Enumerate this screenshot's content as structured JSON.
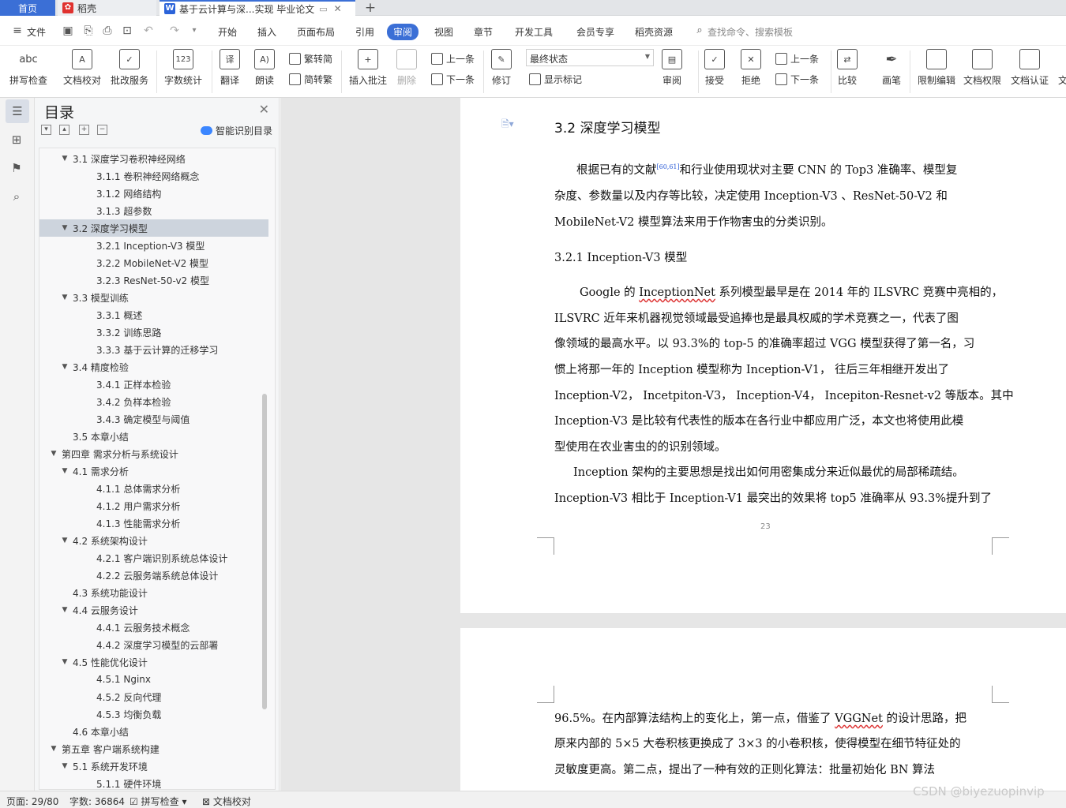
{
  "tabs": {
    "home": "首页",
    "docer": "稻壳",
    "document": "基于云计算与深...实现 毕业论文",
    "add_symbol": "+"
  },
  "menu": {
    "file": "文件",
    "items": [
      "开始",
      "插入",
      "页面布局",
      "引用",
      "审阅",
      "视图",
      "章节",
      "开发工具",
      "会员专享",
      "稻壳资源"
    ],
    "active": "审阅",
    "search_placeholder": "查找命令、搜索模板"
  },
  "ribbon": {
    "spell_check": "拼写检查",
    "doc_proofread": "文档校对",
    "batch_service": "批改服务",
    "word_count": "字数统计",
    "translate": "翻译",
    "read_aloud": "朗读",
    "trad_to_simp": "繁转简",
    "simp_to_trad": "简转繁",
    "insert_comment": "插入批注",
    "delete": "删除",
    "prev": "上一条",
    "next": "下一条",
    "revise": "修订",
    "status_value": "最终状态",
    "show_marks": "显示标记",
    "review": "审阅",
    "accept": "接受",
    "reject": "拒绝",
    "prev2": "上一条",
    "next2": "下一条",
    "compare": "比较",
    "pen": "画笔",
    "restrict_edit": "限制编辑",
    "doc_permission": "文档权限",
    "doc_cert": "文档认证",
    "cut_off": "文"
  },
  "toc": {
    "title": "目录",
    "smart_label": "智能识别目录",
    "items": [
      {
        "label": "3.1  深度学习卷积神经网络",
        "level": 2,
        "expand": "down"
      },
      {
        "label": "3.1.1  卷积神经网络概念",
        "level": 3
      },
      {
        "label": "3.1.2  网络结构",
        "level": 3
      },
      {
        "label": "3.1.3  超参数",
        "level": 3
      },
      {
        "label": "3.2  深度学习模型",
        "level": 2,
        "expand": "down",
        "selected": true
      },
      {
        "label": "3.2.1 Inception-V3 模型",
        "level": 3
      },
      {
        "label": "3.2.2 MobileNet-V2 模型",
        "level": 3
      },
      {
        "label": "3.2.3 ResNet-50-v2 模型",
        "level": 3
      },
      {
        "label": "3.3  模型训练",
        "level": 2,
        "expand": "down"
      },
      {
        "label": "3.3.1  概述",
        "level": 3
      },
      {
        "label": "3.3.2  训练思路",
        "level": 3
      },
      {
        "label": "3.3.3  基于云计算的迁移学习",
        "level": 3
      },
      {
        "label": "3.4  精度检验",
        "level": 2,
        "expand": "down"
      },
      {
        "label": "3.4.1  正样本检验",
        "level": 3
      },
      {
        "label": "3.4.2  负样本检验",
        "level": 3
      },
      {
        "label": "3.4.3  确定模型与阈值",
        "level": 3
      },
      {
        "label": "3.5  本章小结",
        "level": 2
      },
      {
        "label": "第四章  需求分析与系统设计",
        "level": 1,
        "expand": "down"
      },
      {
        "label": "4.1  需求分析",
        "level": 2,
        "expand": "down"
      },
      {
        "label": "4.1.1  总体需求分析",
        "level": 3
      },
      {
        "label": "4.1.2  用户需求分析",
        "level": 3
      },
      {
        "label": "4.1.3  性能需求分析",
        "level": 3
      },
      {
        "label": "4.2  系统架构设计",
        "level": 2,
        "expand": "down"
      },
      {
        "label": "4.2.1  客户端识别系统总体设计",
        "level": 3
      },
      {
        "label": "4.2.2  云服务端系统总体设计",
        "level": 3
      },
      {
        "label": "4.3  系统功能设计",
        "level": 2
      },
      {
        "label": "4.4  云服务设计",
        "level": 2,
        "expand": "down"
      },
      {
        "label": "4.4.1  云服务技术概念",
        "level": 3
      },
      {
        "label": "4.4.2 深度学习模型的云部署",
        "level": 3
      },
      {
        "label": "4.5  性能优化设计",
        "level": 2,
        "expand": "down"
      },
      {
        "label": "4.5.1 Nginx",
        "level": 3
      },
      {
        "label": "4.5.2  反向代理",
        "level": 3
      },
      {
        "label": "4.5.3  均衡负载",
        "level": 3
      },
      {
        "label": "4.6 本章小结",
        "level": 2
      },
      {
        "label": "第五章  客户端系统构建",
        "level": 1,
        "expand": "down"
      },
      {
        "label": "5.1 系统开发环境",
        "level": 2,
        "expand": "down"
      },
      {
        "label": "5.1.1  硬件环境",
        "level": 3
      }
    ]
  },
  "document": {
    "heading": "3.2  深度学习模型",
    "p1_l1a": "根据已有的文献",
    "p1_ref": "[60,61]",
    "p1_l1b": "和行业使用现状对主要  CNN  的  Top3  准确率、模型复",
    "p1_l2": "杂度、参数量以及内存等比较，决定使用  Inception-V3  、ResNet-50-V2  和",
    "p1_l3": "MobileNet-V2  模型算法来用于作物害虫的分类识别。",
    "subheading": "3.2.1 Inception-V3 模型",
    "p2_l1a": "Google 的 ",
    "p2_l1_wavy": "InceptionNet",
    "p2_l1b": " 系列模型最早是在 2014 年的 ILSVRC 竞赛中亮相的，",
    "p2_l2": "ILSVRC 近年来机器视觉领域最受追捧也是最具权威的学术竞赛之一，代表了图",
    "p2_l3": "像领域的最高水平。以 93.3%的 top-5 的准确率超过 VGG 模型获得了第一名，习",
    "p2_l4": "惯上将那一年的  Inception  模型称为  Inception-V1，  往后三年相继开发出了",
    "p2_l5": "Inception-V2，  Incetpiton-V3，  Inception-V4，  Incepiton-Resnet-v2 等版本。其中",
    "p2_l6": "Inception-V3 是比较有代表性的版本在各行业中都应用广泛，本文也将使用此模",
    "p2_l7": "型使用在农业害虫的的识别领域。",
    "p3_l1": "Inception 架构的主要思想是找出如何用密集成分来近似最优的局部稀疏结。",
    "p3_l2": "Inception-V3 相比于  Inception-V1 最突出的效果将 top5 准确率从 93.3%提升到了",
    "page_number": "23",
    "p4_l1a": "96.5%。在内部算法结构上的变化上，第一点，借鉴了 ",
    "p4_l1_wavy": "VGGNet",
    "p4_l1b": " 的设计思路，把",
    "p4_l2": "原来内部的 5×5 大卷积核更换成了 3×3 的小卷积核，使得模型在细节特征处的",
    "p4_l3": "灵敏度更高。第二点，提出了一种有效的正则化算法：批量初始化 BN 算法"
  },
  "statusbar": {
    "page": "页面: 29/80",
    "words": "字数: 36864",
    "spell": "拼写检查",
    "proof": "文档校对",
    "watermark": "CSDN @biyezuopinvip"
  },
  "colors": {
    "accent": "#3b6fd6",
    "selected_toc": "#cdd4dd"
  }
}
